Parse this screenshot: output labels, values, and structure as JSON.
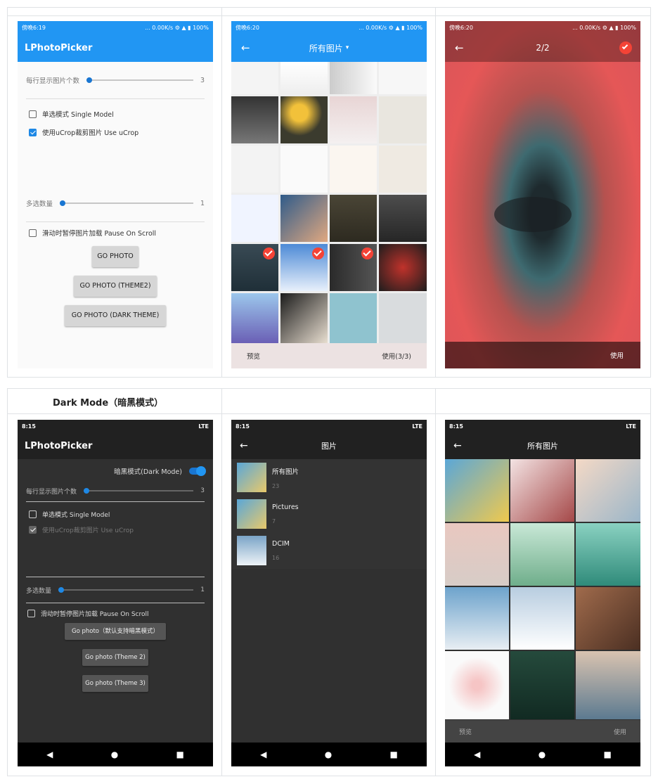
{
  "panels": {
    "light_settings": {
      "status_time": "傍晚6:19",
      "status_right": "... 0.00K/s ⚙ ▲ ▮ 100%",
      "title": "LPhotoPicker",
      "per_row_label": "每行显示图片个数",
      "per_row_value": "3",
      "single_model": "单选模式 Single Model",
      "ucrop": "使用uCrop裁剪图片 Use uCrop",
      "multi_label": "多选数量",
      "multi_value": "1",
      "pause_scroll": "滑动时暂停图片加载 Pause On Scroll",
      "btn1": "GO PHOTO",
      "btn2": "GO PHOTO (THEME2)",
      "btn3": "GO PHOTO (DARK THEME)"
    },
    "light_grid": {
      "status_time": "傍晚6:20",
      "status_right": "... 0.00K/s ⚙ ▲ ▮ 100%",
      "title": "所有图片",
      "preview": "预览",
      "use": "使用(3/3)"
    },
    "light_preview": {
      "status_time": "傍晚6:20",
      "status_right": "... 0.00K/s ⚙ ▲ ▮ 100%",
      "counter": "2/2",
      "use": "使用"
    },
    "dark_settings": {
      "heading": "Dark Mode（暗黑模式）",
      "status_time": "8:15",
      "status_right": "LTE",
      "title": "LPhotoPicker",
      "dark_mode_label": "暗黑模式(Dark Mode)",
      "per_row_label": "每行显示图片个数",
      "per_row_value": "3",
      "single_model": "单选模式 Single Model",
      "ucrop": "使用uCrop裁剪图片 Use uCrop",
      "multi_label": "多选数量",
      "multi_value": "1",
      "pause_scroll": "滑动时暂停图片加载 Pause On Scroll",
      "btn1": "Go photo（默认支持暗黑模式）",
      "btn2": "Go photo (Theme 2)",
      "btn3": "Go photo (Theme 3)"
    },
    "dark_folders": {
      "status_time": "8:15",
      "status_right": "LTE",
      "title": "图片",
      "folders": [
        {
          "name": "所有图片",
          "count": "23"
        },
        {
          "name": "Pictures",
          "count": "7"
        },
        {
          "name": "DCIM",
          "count": "16"
        }
      ]
    },
    "dark_grid": {
      "status_time": "8:15",
      "status_right": "LTE",
      "title": "所有图片",
      "preview": "预览",
      "use": "使用"
    }
  },
  "colors": {
    "accent_blue": "#2196f3",
    "dark_bg": "#303030",
    "dark_bar": "#212121",
    "check_red": "#f44336"
  }
}
